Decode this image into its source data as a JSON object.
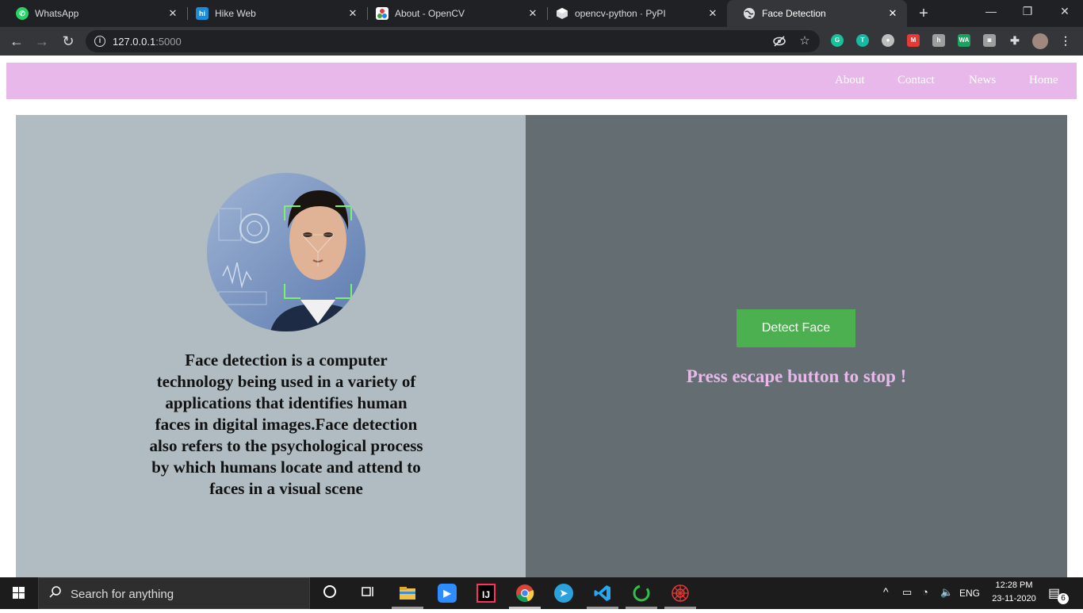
{
  "browser": {
    "tabs": [
      {
        "title": "WhatsApp",
        "icon": "whatsapp-icon",
        "color": "#25d366"
      },
      {
        "title": "Hike Web",
        "icon": "hike-icon",
        "color": "#1a8cd8"
      },
      {
        "title": "About - OpenCV",
        "icon": "opencv-icon",
        "color": "#ffffff"
      },
      {
        "title": "opencv-python · PyPI",
        "icon": "pypi-icon",
        "color": "#dadce0"
      },
      {
        "title": "Face Detection",
        "icon": "globe-icon",
        "color": "#dadce0"
      }
    ],
    "active_tab": 4,
    "url_host": "127.0.0.1",
    "url_port": ":5000"
  },
  "site": {
    "nav": {
      "about": "About",
      "contact": "Contact",
      "news": "News",
      "home": "Home"
    },
    "description": "Face detection is a computer technology being used in a variety of applications that identifies human faces in digital images.Face detection also refers to the psychological process by which humans locate and attend to faces in a visual scene",
    "detect_button": "Detect Face",
    "escape_message": "Press escape button to stop !",
    "colors": {
      "navbar": "#e8b8ea",
      "left_panel": "#b0bcc2",
      "right_panel": "#636d72",
      "button": "#4caf50"
    }
  },
  "taskbar": {
    "search_placeholder": "Search for anything",
    "language": "ENG",
    "time": "12:28 PM",
    "date": "23-11-2020",
    "notification_count": "6"
  }
}
